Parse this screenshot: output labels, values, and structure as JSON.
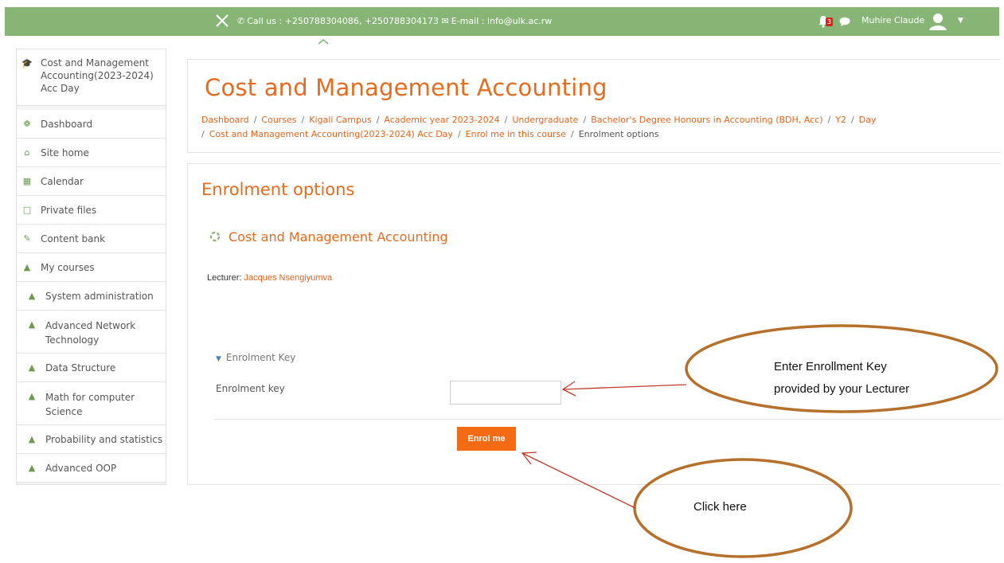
{
  "topbar": {
    "contact": "Call us : +250788304086, +250788304173",
    "email": "E-mail : info@ulk.ac.rw",
    "notification_count": "3",
    "username": "Muhire Claude"
  },
  "sidebar": {
    "course": "Cost and Management Accounting(2023-2024) Acc Day",
    "items": [
      {
        "label": "Dashboard",
        "icon": "dashboard-icon"
      },
      {
        "label": "Site home",
        "icon": "home-icon"
      },
      {
        "label": "Calendar",
        "icon": "calendar-icon"
      },
      {
        "label": "Private files",
        "icon": "file-icon"
      },
      {
        "label": "Content bank",
        "icon": "brush-icon"
      },
      {
        "label": "My courses",
        "icon": "graduation-cap-icon"
      },
      {
        "label": "System administration",
        "icon": "graduation-cap-icon"
      },
      {
        "label": "Advanced Network Technology",
        "icon": "graduation-cap-icon"
      },
      {
        "label": "Data Structure",
        "icon": "graduation-cap-icon"
      },
      {
        "label": "Math for computer Science",
        "icon": "graduation-cap-icon"
      },
      {
        "label": "Probability and statistics",
        "icon": "graduation-cap-icon"
      },
      {
        "label": "Advanced OOP",
        "icon": "graduation-cap-icon"
      }
    ]
  },
  "header": {
    "title": "Cost and Management Accounting",
    "breadcrumb": [
      "Dashboard",
      "Courses",
      "Kigali Campus",
      "Academic year 2023-2024",
      "Undergraduate",
      "Bachelor's Degree Honours in Accounting (BDH, Acc)",
      "Y2",
      "Day",
      "Cost and Management Accounting(2023-2024) Acc Day",
      "Enrol me in this course",
      "Enrolment options"
    ]
  },
  "main": {
    "section_title": "Enrolment options",
    "course_name": "Cost and Management Accounting",
    "lecturer_label": "Lecturer:",
    "lecturer_name": "Jacques Nsengiyumva",
    "fieldset_legend": "Enrolment Key",
    "key_label": "Enrolment key",
    "key_value": "",
    "enrol_button": "Enrol me"
  },
  "annotations": {
    "callout_key_line1": "Enter Enrollment Key",
    "callout_key_line2": "provided by your Lecturer",
    "callout_click": "Click here"
  },
  "colors": {
    "topbar": "#86b576",
    "accent": "#e36c1f",
    "button": "#f56b13",
    "callout_stroke": "#b5702b",
    "arrow": "#c0392b"
  }
}
